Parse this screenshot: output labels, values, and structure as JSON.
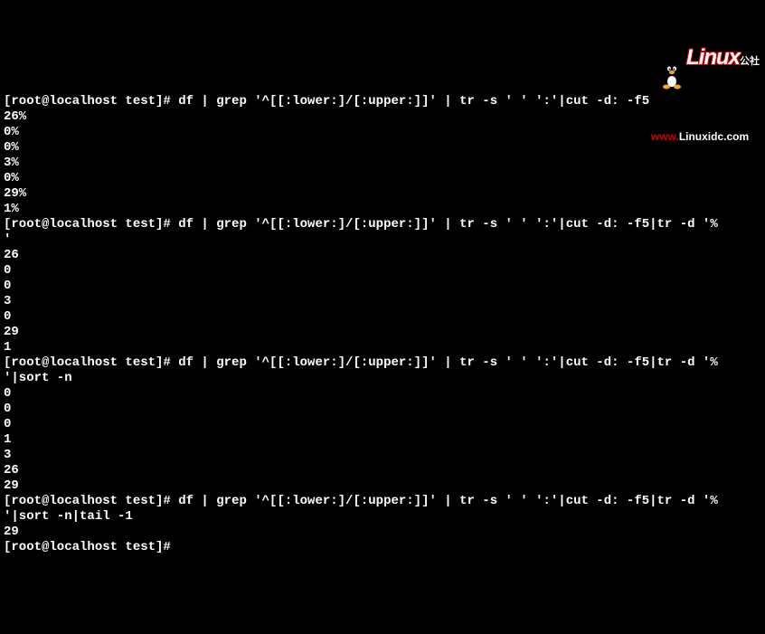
{
  "watermark": {
    "brand": "Linux",
    "sub": "公社",
    "url_www": "www.",
    "url_rest": "Linuxidc.com"
  },
  "blocks": [
    {
      "prompt": "[root@localhost test]# ",
      "command": "df | grep '^[[:lower:]/[:upper:]]' | tr -s ' ' ':'|cut -d: -f5",
      "output": [
        "26%",
        "0%",
        "0%",
        "3%",
        "0%",
        "29%",
        "1%"
      ]
    },
    {
      "prompt": "[root@localhost test]# ",
      "command": "df | grep '^[[:lower:]/[:upper:]]' | tr -s ' ' ':'|cut -d: -f5|tr -d '%'",
      "output": [
        "26",
        "0",
        "0",
        "3",
        "0",
        "29",
        "1"
      ]
    },
    {
      "prompt": "[root@localhost test]# ",
      "command": "df | grep '^[[:lower:]/[:upper:]]' | tr -s ' ' ':'|cut -d: -f5|tr -d '%'|sort -n",
      "output": [
        "0",
        "0",
        "0",
        "1",
        "3",
        "26",
        "29"
      ]
    },
    {
      "prompt": "[root@localhost test]# ",
      "command": "df | grep '^[[:lower:]/[:upper:]]' | tr -s ' ' ':'|cut -d: -f5|tr -d '%'|sort -n|tail -1",
      "output": [
        "29"
      ]
    }
  ],
  "final_prompt": "[root@localhost test]# "
}
